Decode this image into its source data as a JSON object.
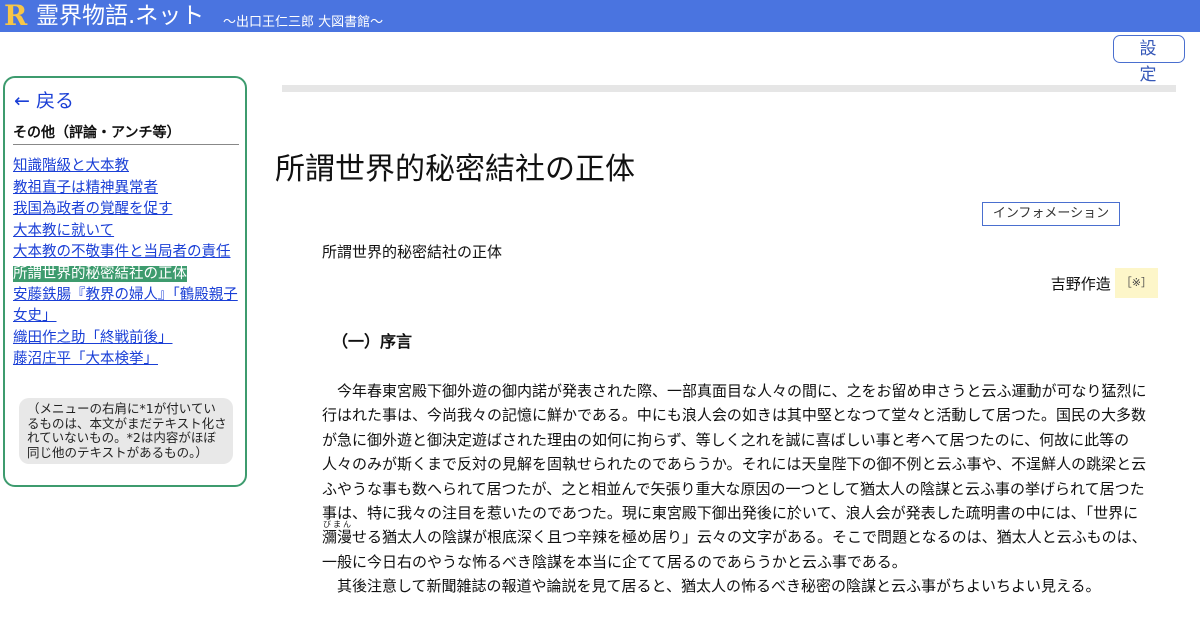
{
  "header": {
    "logo_letter": "R",
    "site_name": "霊界物語.ネット",
    "subtitle": "～出口王仁三郎 大図書館～"
  },
  "settings_button": "設 定",
  "sidebar": {
    "back_label": "← 戻る",
    "section_title": "その他（評論・アンチ等）",
    "items": [
      {
        "label": "知識階級と大本教",
        "active": false
      },
      {
        "label": "教祖直子は精神異常者",
        "active": false
      },
      {
        "label": "我国為政者の覚醒を促す",
        "active": false
      },
      {
        "label": "大本教に就いて",
        "active": false
      },
      {
        "label": "大本教の不敬事件と当局者の責任",
        "active": false
      },
      {
        "label": "所謂世界的秘密結社の正体",
        "active": true
      },
      {
        "label": "安藤鉄腸『教界の婦人』「鶴殿親子女史」",
        "active": false
      },
      {
        "label": "織田作之助「終戦前後」",
        "active": false
      },
      {
        "label": "藤沼庄平「大本検挙」",
        "active": false
      }
    ],
    "note": "（メニューの右肩に*1が付いているものは、本文がまだテキスト化されていないもの。*2は内容がほぼ同じ他のテキストがあるもの。）"
  },
  "main": {
    "title": "所謂世界的秘密結社の正体",
    "info_button": "インフォメーション",
    "doc_heading": "所謂世界的秘密結社の正体",
    "author": "吉野作造",
    "author_note": "［※］",
    "chapter_heading": "（一）序言",
    "paragraph1_before": "今年春東宮殿下御外遊の御内諾が発表された際、一部真面目な人々の間に、之をお留め申さうと云ふ運動が可なり猛烈に行はれた事は、今尚我々の記憶に鮮かである。中にも浪人会の如きは其中堅となつて堂々と活動して居つた。国民の大多数が急に御外遊と御決定遊ばされた理由の如何に拘らず、等しく之れを誠に喜ばしい事と考へて居つたのに、何故に此等の人々のみが斯くまで反対の見解を固執せられたのであらうか。それには天皇陛下の御不例と云ふ事や、不逞鮮人の跳梁と云ふやうな事も数へられて居つたが、之と相並んで矢張り重大な原因の一つとして猶太人の陰謀と云ふ事の挙げられて居つた事は、特に我々の注目を惹いたのであつた。現に東宮殿下御出発後に於いて、浪人会が発表した疏明書の中には、「世界に",
    "ruby_base": "瀰漫",
    "ruby_text": "びまん",
    "paragraph1_after": "せる猶太人の陰謀が根底深く且つ辛辣を極め居り」云々の文字がある。そこで問題となるのは、猶太人と云ふものは、一般に今日右のやうな怖るべき陰謀を本当に企てて居るのであらうかと云ふ事である。",
    "paragraph2": "其後注意して新聞雑誌の報道や論説を見て居ると、猶太人の怖るべき秘密の陰謀と云ふ事がちよいちよい見える。"
  },
  "colors": {
    "header_bg": "#4a74e0",
    "logo": "#f7c648",
    "sidebar_border": "#3d9b6e",
    "active_item_bg": "#3d9b6e",
    "link": "#1a3fd6"
  }
}
